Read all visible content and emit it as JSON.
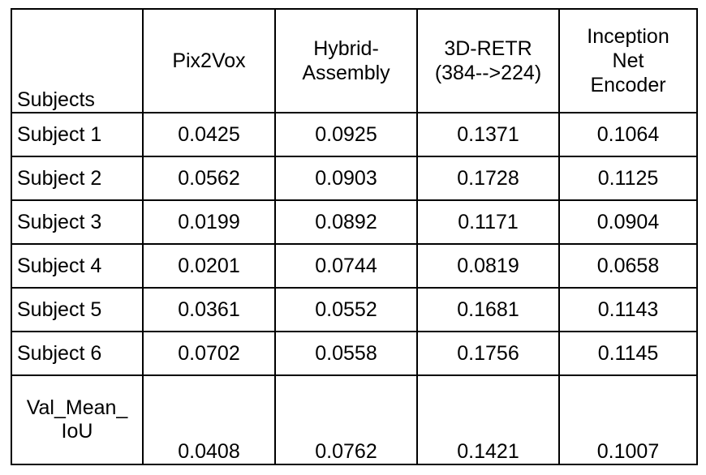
{
  "table": {
    "columns": [
      {
        "key": "subjects",
        "label": "Subjects"
      },
      {
        "key": "pix2vox",
        "label": "Pix2Vox"
      },
      {
        "key": "hybrid",
        "label_line1": "Hybrid-",
        "label_line2": "Assembly"
      },
      {
        "key": "retr",
        "label_line1": "3D-RETR",
        "label_line2": "(384-->224)"
      },
      {
        "key": "inception",
        "label_line1": "Inception",
        "label_line2": "Net",
        "label_line3": "Encoder"
      }
    ],
    "rows": [
      {
        "subject": "Subject 1",
        "pix2vox": "0.0425",
        "hybrid": "0.0925",
        "retr": "0.1371",
        "inception": "0.1064"
      },
      {
        "subject": "Subject 2",
        "pix2vox": "0.0562",
        "hybrid": "0.0903",
        "retr": "0.1728",
        "inception": "0.1125"
      },
      {
        "subject": "Subject 3",
        "pix2vox": "0.0199",
        "hybrid": "0.0892",
        "retr": "0.1171",
        "inception": "0.0904"
      },
      {
        "subject": "Subject 4",
        "pix2vox": "0.0201",
        "hybrid": "0.0744",
        "retr": "0.0819",
        "inception": "0.0658"
      },
      {
        "subject": "Subject 5",
        "pix2vox": "0.0361",
        "hybrid": "0.0552",
        "retr": "0.1681",
        "inception": "0.1143"
      },
      {
        "subject": "Subject 6",
        "pix2vox": "0.0702",
        "hybrid": "0.0558",
        "retr": "0.1756",
        "inception": "0.1145"
      }
    ],
    "summary": {
      "label_line1": "Val_Mean_",
      "label_line2": "IoU",
      "pix2vox": "0.0408",
      "hybrid": "0.0762",
      "retr": "0.1421",
      "inception": "0.1007"
    }
  },
  "chart_data": {
    "type": "table",
    "title": "",
    "columns": [
      "Subjects",
      "Pix2Vox",
      "Hybrid-Assembly",
      "3D-RETR (384-->224)",
      "Inception Net Encoder"
    ],
    "rows": [
      [
        "Subject 1",
        0.0425,
        0.0925,
        0.1371,
        0.1064
      ],
      [
        "Subject 2",
        0.0562,
        0.0903,
        0.1728,
        0.1125
      ],
      [
        "Subject 3",
        0.0199,
        0.0892,
        0.1171,
        0.0904
      ],
      [
        "Subject 4",
        0.0201,
        0.0744,
        0.0819,
        0.0658
      ],
      [
        "Subject 5",
        0.0361,
        0.0552,
        0.1681,
        0.1143
      ],
      [
        "Subject 6",
        0.0702,
        0.0558,
        0.1756,
        0.1145
      ],
      [
        "Val_Mean_IoU",
        0.0408,
        0.0762,
        0.1421,
        0.1007
      ]
    ],
    "series": [
      {
        "name": "Pix2Vox",
        "values": [
          0.0425,
          0.0562,
          0.0199,
          0.0201,
          0.0361,
          0.0702
        ],
        "mean": 0.0408
      },
      {
        "name": "Hybrid-Assembly",
        "values": [
          0.0925,
          0.0903,
          0.0892,
          0.0744,
          0.0552,
          0.0558
        ],
        "mean": 0.0762
      },
      {
        "name": "3D-RETR (384-->224)",
        "values": [
          0.1371,
          0.1728,
          0.1171,
          0.0819,
          0.1681,
          0.1756
        ],
        "mean": 0.1421
      },
      {
        "name": "Inception Net Encoder",
        "values": [
          0.1064,
          0.1125,
          0.0904,
          0.0658,
          0.1143,
          0.1145
        ],
        "mean": 0.1007
      }
    ],
    "categories": [
      "Subject 1",
      "Subject 2",
      "Subject 3",
      "Subject 4",
      "Subject 5",
      "Subject 6"
    ],
    "xlabel": "Subjects",
    "ylabel": "Val_Mean_IoU"
  }
}
